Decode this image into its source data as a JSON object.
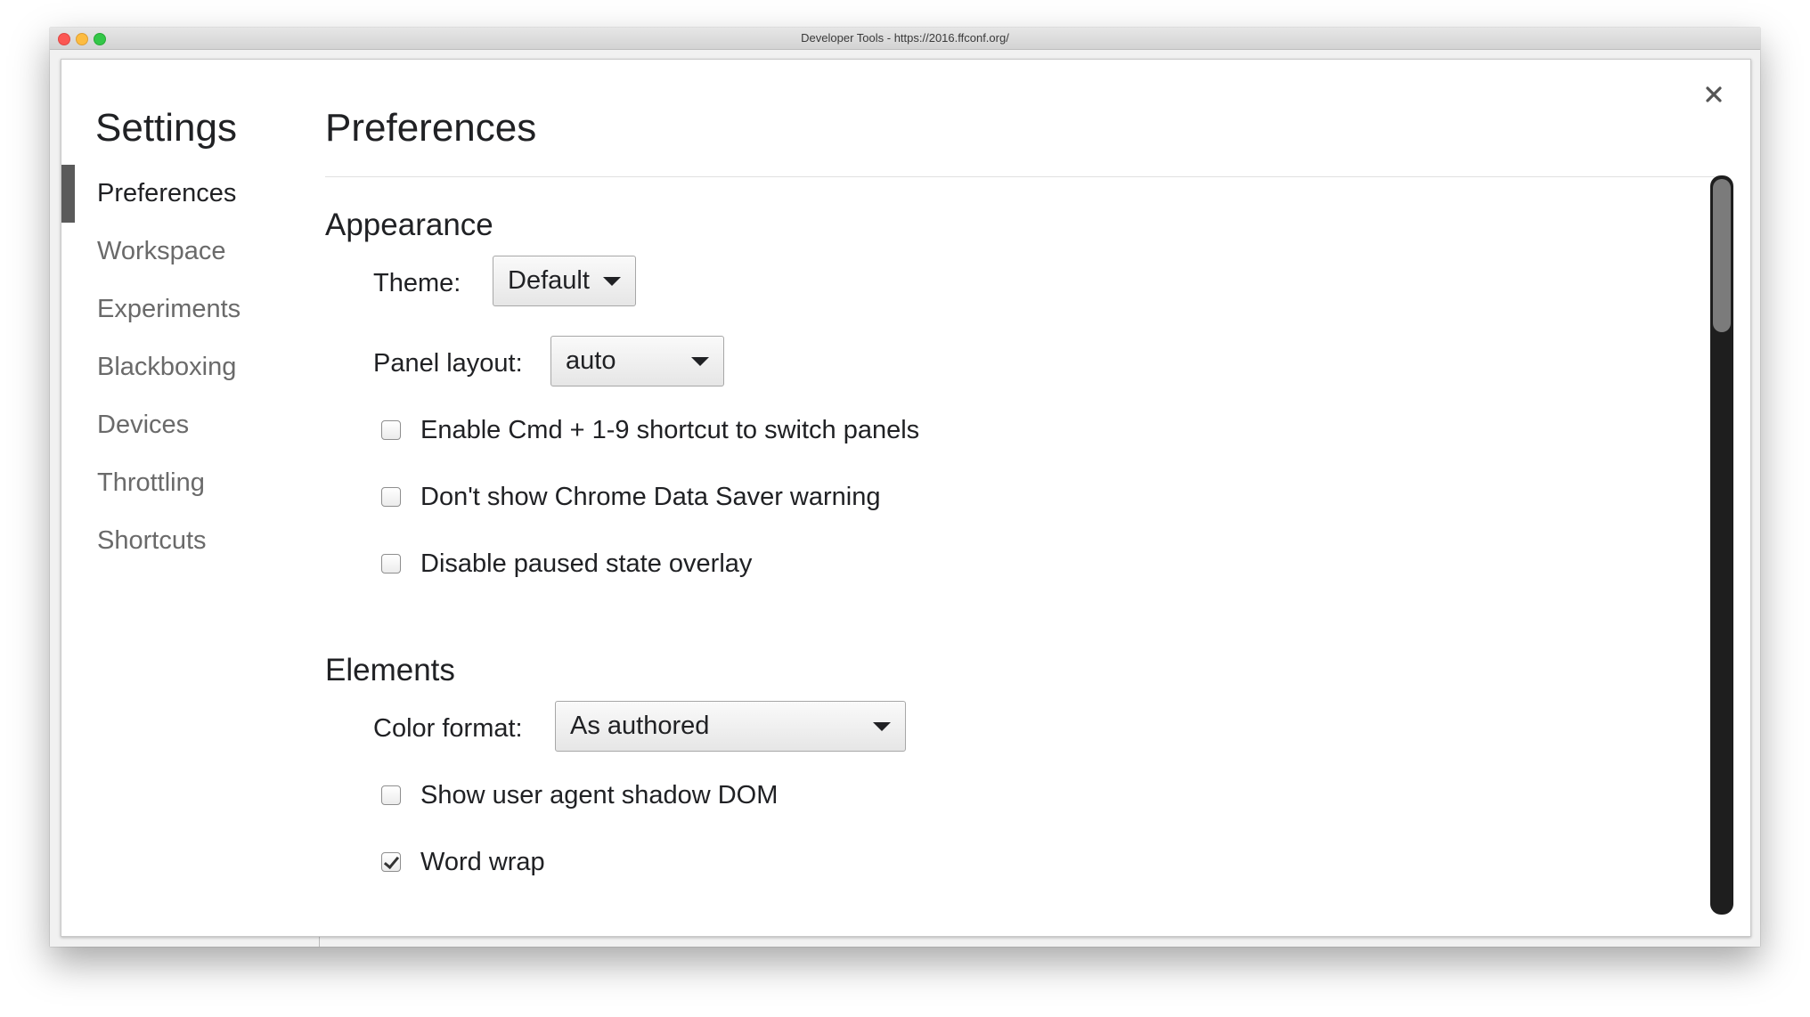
{
  "window": {
    "title": "Developer Tools - https://2016.ffconf.org/"
  },
  "sidebar": {
    "title": "Settings",
    "items": [
      {
        "label": "Preferences",
        "selected": true
      },
      {
        "label": "Workspace"
      },
      {
        "label": "Experiments"
      },
      {
        "label": "Blackboxing"
      },
      {
        "label": "Devices"
      },
      {
        "label": "Throttling"
      },
      {
        "label": "Shortcuts"
      }
    ]
  },
  "main": {
    "title": "Preferences",
    "appearance": {
      "title": "Appearance",
      "theme_label": "Theme:",
      "theme_value": "Default",
      "panel_layout_label": "Panel layout:",
      "panel_layout_value": "auto",
      "checkboxes": [
        {
          "label": "Enable Cmd + 1-9 shortcut to switch panels",
          "checked": false
        },
        {
          "label": "Don't show Chrome Data Saver warning",
          "checked": false
        },
        {
          "label": "Disable paused state overlay",
          "checked": false
        }
      ]
    },
    "elements": {
      "title": "Elements",
      "color_format_label": "Color format:",
      "color_format_value": "As authored",
      "checkboxes": [
        {
          "label": "Show user agent shadow DOM",
          "checked": false
        },
        {
          "label": "Word wrap",
          "checked": true
        }
      ]
    }
  },
  "icons": {
    "close": "close-icon"
  },
  "colors": {
    "selected_indicator": "#5a5a5a",
    "scrollbar_track": "#1e1e1e",
    "scrollbar_thumb": "#7b7b7b"
  }
}
